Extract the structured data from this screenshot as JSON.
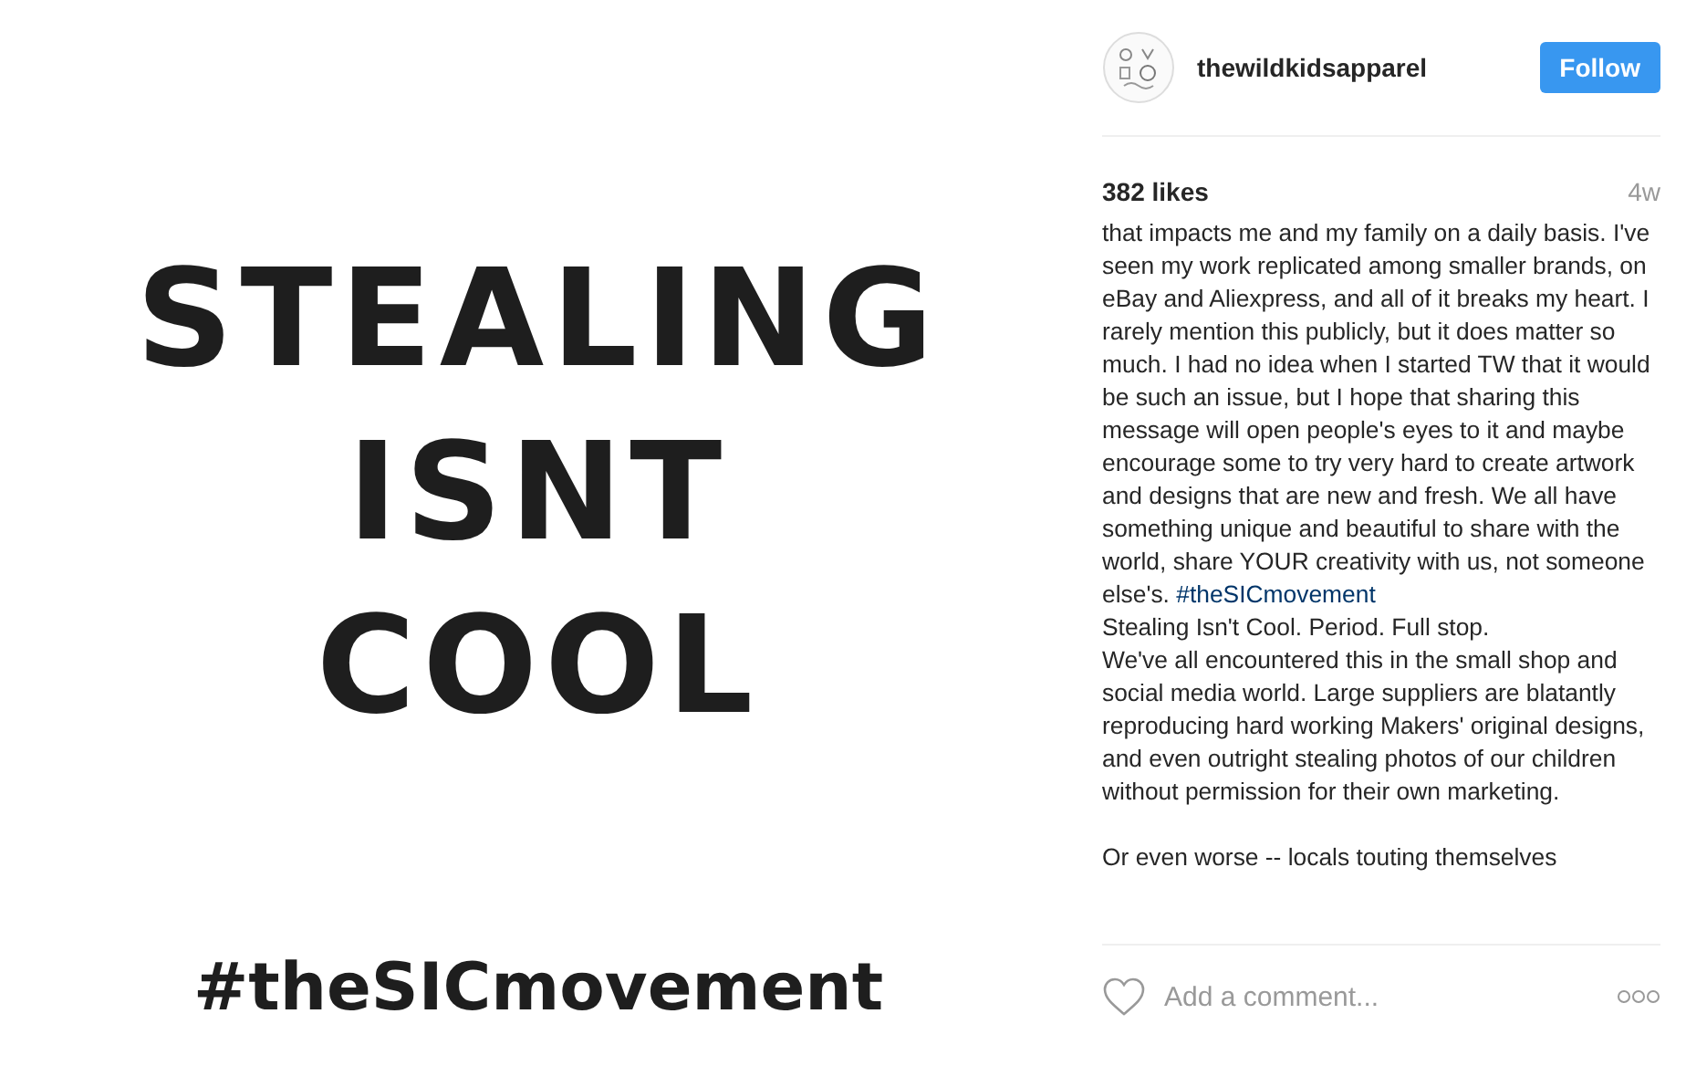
{
  "post_image": {
    "headline": [
      "STEALING",
      "ISNT",
      "COOL"
    ],
    "hashtag": "#theSICmovement"
  },
  "header": {
    "username": "thewildkidsapparel",
    "follow_button": "Follow"
  },
  "likes": "382 likes",
  "time": "4w",
  "caption": [
    {
      "parts": [
        {
          "kind": "text",
          "text": "that impacts me and my family on a daily basis. I've seen my work replicated among smaller brands, on eBay and Aliexpress, and all of it breaks my heart. I rarely mention this publicly, but it does matter so much. I had no idea when I started TW that it would be such an issue, but I hope that sharing this message will open people's eyes to it and maybe encourage some to try very hard to create artwork and designs that are new and fresh. We all have something unique and beautiful to share with the world, share YOUR creativity with us, not someone else's. "
        },
        {
          "kind": "hashtag",
          "text": "#theSICmovement"
        }
      ]
    },
    {
      "parts": [
        {
          "kind": "text",
          "text": "Stealing Isn't Cool. Period. Full stop."
        }
      ]
    },
    {
      "parts": [
        {
          "kind": "text",
          "text": "We've all encountered this in the small shop and social media world. Large suppliers are blatantly reproducing hard working Makers' original designs, and even outright stealing photos of our children without permission for their own marketing."
        }
      ]
    },
    {
      "parts": [
        {
          "kind": "text",
          "text": "Or even worse -- locals touting themselves"
        }
      ]
    }
  ],
  "comment_field": {
    "placeholder": "Add a comment..."
  }
}
